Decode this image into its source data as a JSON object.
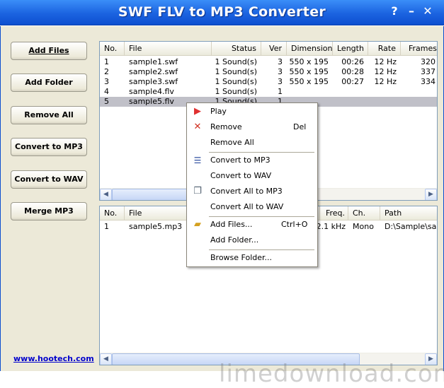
{
  "window": {
    "title": "SWF FLV to MP3 Converter",
    "help": "?",
    "minimize": "–",
    "close": "✕",
    "title_color": "#1b63e0"
  },
  "buttons": {
    "add_files": "Add Files",
    "add_folder": "Add Folder",
    "remove_all": "Remove All",
    "convert_mp3": "Convert to MP3",
    "convert_wav": "Convert to WAV",
    "merge_mp3": "Merge MP3"
  },
  "link": "www.hootech.com",
  "top_list": {
    "columns": [
      "No.",
      "File",
      "Status",
      "Ver",
      "Dimension",
      "Length",
      "Rate",
      "Frames"
    ],
    "rows": [
      [
        "1",
        "sample1.swf",
        "1 Sound(s)",
        "3",
        "550 x 195",
        "00:26",
        "12 Hz",
        "320"
      ],
      [
        "2",
        "sample2.swf",
        "1 Sound(s)",
        "3",
        "550 x 195",
        "00:28",
        "12 Hz",
        "337"
      ],
      [
        "3",
        "sample3.swf",
        "1 Sound(s)",
        "3",
        "550 x 195",
        "00:27",
        "12 Hz",
        "334"
      ],
      [
        "4",
        "sample4.flv",
        "1 Sound(s)",
        "1",
        "",
        "",
        "",
        ""
      ],
      [
        "5",
        "sample5.flv",
        "1 Sound(s)",
        "1",
        "",
        "",
        "",
        ""
      ]
    ],
    "selected_row": 5
  },
  "bottom_list": {
    "columns": [
      "No.",
      "File",
      "Freq.",
      "Ch.",
      "Path"
    ],
    "rows": [
      [
        "1",
        "sample5.mp3",
        "2.1 kHz",
        "Mono",
        "D:\\Sample\\samp"
      ]
    ]
  },
  "context_menu": {
    "play": "Play",
    "remove": "Remove",
    "remove_shortcut": "Del",
    "remove_all": "Remove All",
    "convert_mp3": "Convert to MP3",
    "convert_wav": "Convert to WAV",
    "convert_all_mp3": "Convert All to MP3",
    "convert_all_wav": "Convert All to WAV",
    "add_files": "Add Files...",
    "add_files_shortcut": "Ctrl+O",
    "add_folder": "Add Folder...",
    "browse_folder": "Browse Folder..."
  },
  "watermark": "limedownload.com"
}
